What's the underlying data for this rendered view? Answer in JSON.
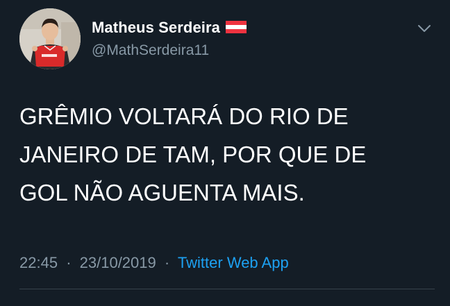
{
  "tweet": {
    "display_name": "Matheus Serdeira",
    "flag_icon": "austria-flag-icon",
    "handle": "@MathSerdeira11",
    "body_lines": [
      "GRÊMIO VOLTARÁ DO RIO DE",
      "JANEIRO DE TAM, POR QUE DE",
      "GOL NÃO AGUENTA MAIS."
    ],
    "time": "22:45",
    "separator": "·",
    "date": "23/10/2019",
    "source": "Twitter Web App"
  },
  "colors": {
    "background": "#141d26",
    "text_primary": "#ffffff",
    "text_secondary": "#8899a6",
    "link": "#1da1f2",
    "divider": "#38444d"
  }
}
